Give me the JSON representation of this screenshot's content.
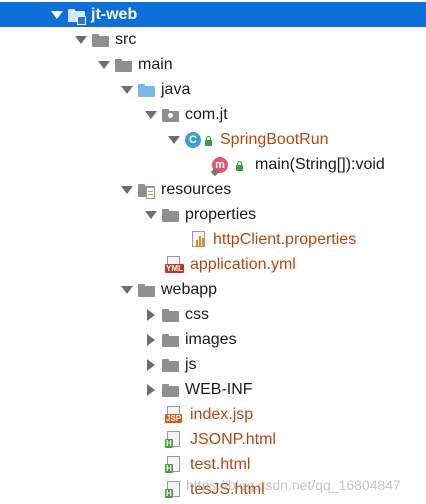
{
  "tree": {
    "project": {
      "label": "jt-web"
    },
    "src": {
      "label": "src"
    },
    "main": {
      "label": "main"
    },
    "java": {
      "label": "java"
    },
    "package": {
      "label": "com.jt"
    },
    "class": {
      "label": "SpringBootRun",
      "icon_letter": "C"
    },
    "method": {
      "label": "main(String[]):void",
      "icon_letter": "m"
    },
    "resources": {
      "label": "resources"
    },
    "properties_folder": {
      "label": "properties"
    },
    "httpclient_file": {
      "label": "httpClient.properties"
    },
    "application_file": {
      "label": "application.yml",
      "icon_text": "YML"
    },
    "webapp": {
      "label": "webapp"
    },
    "css": {
      "label": "css"
    },
    "images": {
      "label": "images"
    },
    "js": {
      "label": "js"
    },
    "webinf": {
      "label": "WEB-INF"
    },
    "index_file": {
      "label": "index.jsp",
      "icon_text": "JSP"
    },
    "jsonp_file": {
      "label": "JSONP.html",
      "icon_text": "H"
    },
    "test_file": {
      "label": "test.html",
      "icon_text": "H"
    },
    "testjs_file": {
      "label": "tesJS.html",
      "icon_text": "H"
    }
  },
  "watermark": "https://blog.csdn.net/qq_16804847",
  "colors": {
    "selection": "#0d6fd8",
    "resource_file_text": "#b5460f",
    "folder_gray": "#8f8f8f",
    "source_folder_blue": "#79b8e8",
    "class_icon": "#3f9ed8",
    "method_icon": "#e2566f"
  }
}
